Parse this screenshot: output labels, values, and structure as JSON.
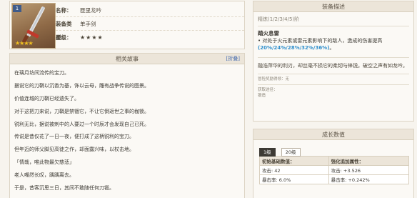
{
  "weapon": {
    "level_badge": "1",
    "rows": [
      {
        "label": "名称：",
        "value": "匣里龙吟"
      },
      {
        "label": "装备类型：",
        "value": "单手剑"
      },
      {
        "label": "星级：",
        "value": "★★★★"
      }
    ],
    "rarity_stars": "★★★★"
  },
  "story": {
    "title": "相关故事",
    "fold_label": "[折叠]",
    "lines": [
      "在璃月坊间流传的宝刀。",
      "据说它的刀鞘以沉香为基，饰以云母，雕有战争传说的图景。",
      "价值连城的刀鞘已经遗失了。",
      "对于这把刀来说，刀鞘是禁锢它，不让它倒返世之事的枷锁。",
      "锐利无比，据说被刺中的人要过一个时辰才会发现自己已死。",
      "传说是昔仅花了一日一夜，便打成了这柄锐利的宝刀。",
      "但年迈的师父脚见高徒之作，却面露兴味，以杖击地。",
      "「情哉，唯此物最欠慈悲」",
      "老人嘴然长叹，踽踽离去。",
      "于是，昔客沉思三日，其间不敢随任何刀锻。"
    ]
  },
  "desc": {
    "title": "装备描述",
    "refinement": "精炼(1/2/3/4/5)阶",
    "effect_title": "踏火息雷",
    "effect_prefix": "• 对处于火元素或雷元素影响下的敌人，造成的伤害提高",
    "effect_values": "(20%/24%/28%/32%/36%)",
    "effect_suffix": "。",
    "flavor": "融浩萍华的利刃，却丝毫不损它的柔韧与锋锐。破空之声有如龙吟。",
    "source_note": "冒险奖励得领：无",
    "obtain_label": "获取途径：",
    "obtain_value": "锻造"
  },
  "growth": {
    "title": "成长数值",
    "tabs": [
      "1级",
      "20级"
    ],
    "headers": [
      "初始基础数值：",
      "强化追加属性："
    ],
    "rows": [
      [
        "攻击: 42",
        "攻击: +3.526"
      ],
      [
        "暴击率: 6.0%",
        "暴击率: +0.242%"
      ]
    ]
  }
}
